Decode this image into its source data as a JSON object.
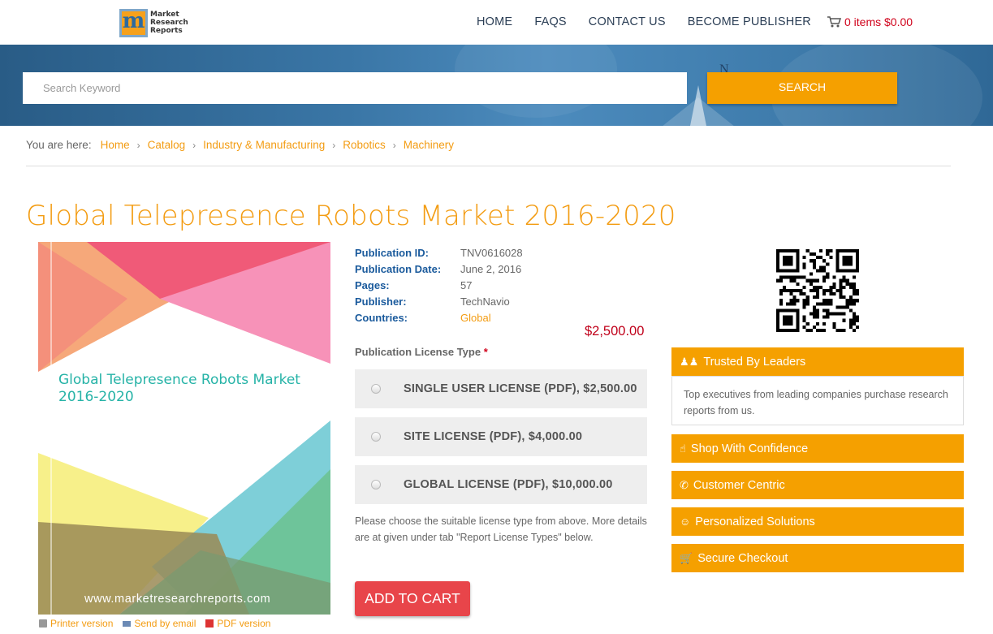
{
  "header": {
    "logo_text": [
      "Market",
      "Research",
      "Reports"
    ],
    "nav": [
      "HOME",
      "FAQS",
      "CONTACT US",
      "BECOME PUBLISHER"
    ],
    "cart_label": "0 items $0.00"
  },
  "search": {
    "placeholder": "Search Keyword",
    "button_label": "SEARCH"
  },
  "breadcrumb": {
    "label": "You are here:",
    "items": [
      "Home",
      "Catalog",
      "Industry & Manufacturing",
      "Robotics",
      "Machinery"
    ]
  },
  "product": {
    "title": "Global Telepresence Robots Market 2016-2020",
    "cover_title": "Global Telepresence Robots Market 2016-2020",
    "cover_url": "www.marketresearchreports.com",
    "details": [
      {
        "key": "Publication ID:",
        "value": "TNV0616028"
      },
      {
        "key": "Publication Date:",
        "value": "June 2, 2016"
      },
      {
        "key": "Pages:",
        "value": "57"
      },
      {
        "key": "Publisher:",
        "value": "TechNavio"
      },
      {
        "key": "Countries:",
        "value": "Global"
      }
    ],
    "price": "$2,500.00",
    "license_label": "Publication License Type",
    "license_required": "*",
    "licenses": [
      "SINGLE USER LICENSE (PDF), $2,500.00",
      "SITE LICENSE (PDF), $4,000.00",
      "GLOBAL LICENSE (PDF), $10,000.00"
    ],
    "note": "Please choose the suitable license type from above. More details are at given under tab \"Report License Types\" below.",
    "add_to_cart": "ADD TO CART",
    "tools": [
      "Printer version",
      "Send by email",
      "PDF version"
    ]
  },
  "sidebar": {
    "trusted_title": "Trusted By Leaders",
    "trusted_body": "Top executives from leading companies purchase research reports from us.",
    "panels": [
      "Shop With Confidence",
      "Customer Centric",
      "Personalized Solutions",
      "Secure Checkout"
    ]
  },
  "colors": {
    "accent": "#f39c12",
    "panel": "#f5a000",
    "price": "#c0001a",
    "add_to_cart": "#e8454a",
    "detail_key": "#1a5a9c"
  }
}
